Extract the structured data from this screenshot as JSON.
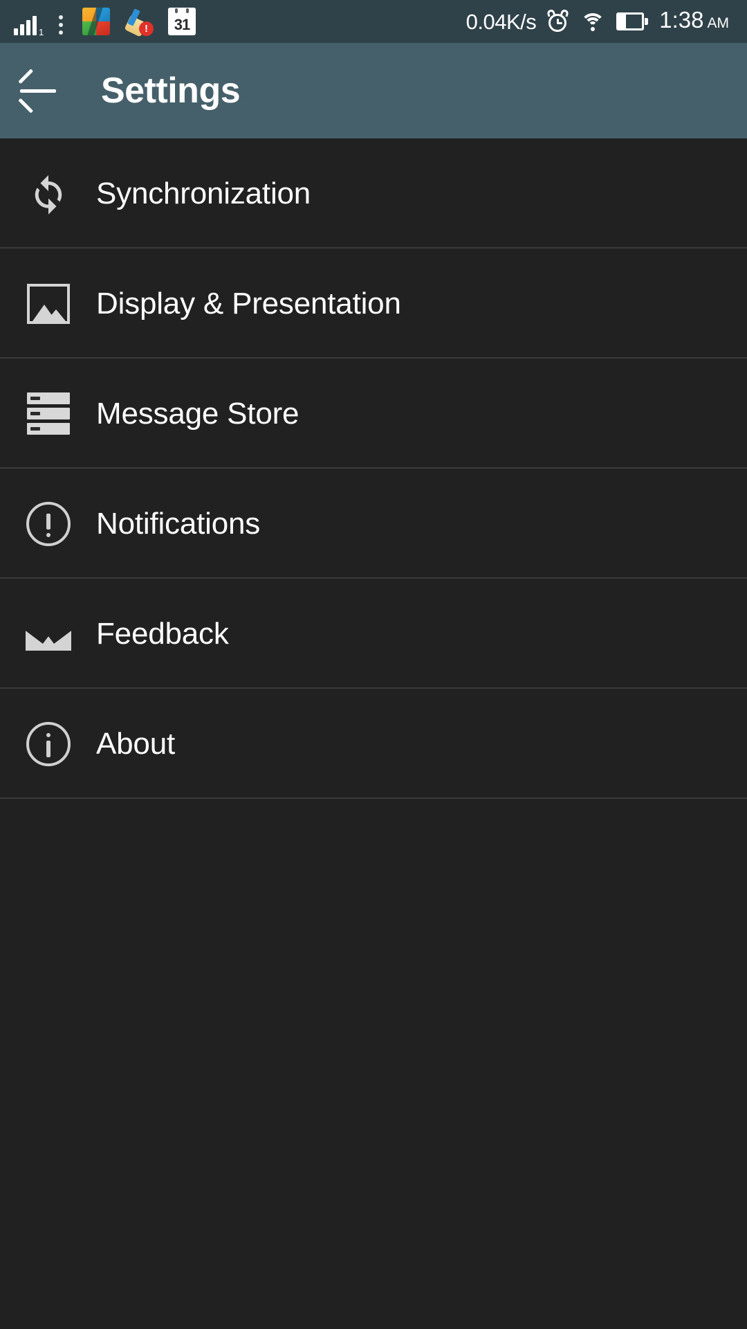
{
  "status_bar": {
    "signal_icon": "signal-bars-icon",
    "overflow_icon": "vertical-dots-icon",
    "tray_icons": [
      {
        "name": "archive-app-icon",
        "label": ""
      },
      {
        "name": "cleaner-app-icon",
        "label": "!"
      },
      {
        "name": "calendar-icon",
        "label": "31"
      }
    ],
    "network_speed": "0.04K/s",
    "alarm_icon": "alarm-clock-icon",
    "wifi_icon": "wifi-icon",
    "battery_icon": "battery-icon",
    "battery_level_percent": 33,
    "time": "1:38",
    "am_pm": "AM"
  },
  "app_bar": {
    "back_icon": "back-arrow-icon",
    "title": "Settings",
    "background_color": "#45606a"
  },
  "colors": {
    "status_bar_bg": "#2f4249",
    "app_bar_bg": "#45606a",
    "list_bg": "#212121",
    "divider": "#3a3a3a",
    "text_primary": "#ffffff",
    "icon_tint": "#d4d4d4"
  },
  "settings_list": {
    "items": [
      {
        "label": "Synchronization",
        "icon": "sync-icon"
      },
      {
        "label": "Display & Presentation",
        "icon": "image-icon"
      },
      {
        "label": "Message Store",
        "icon": "storage-stack-icon"
      },
      {
        "label": "Notifications",
        "icon": "exclamation-circle-icon"
      },
      {
        "label": "Feedback",
        "icon": "envelope-icon"
      },
      {
        "label": "About",
        "icon": "info-circle-icon"
      }
    ]
  }
}
